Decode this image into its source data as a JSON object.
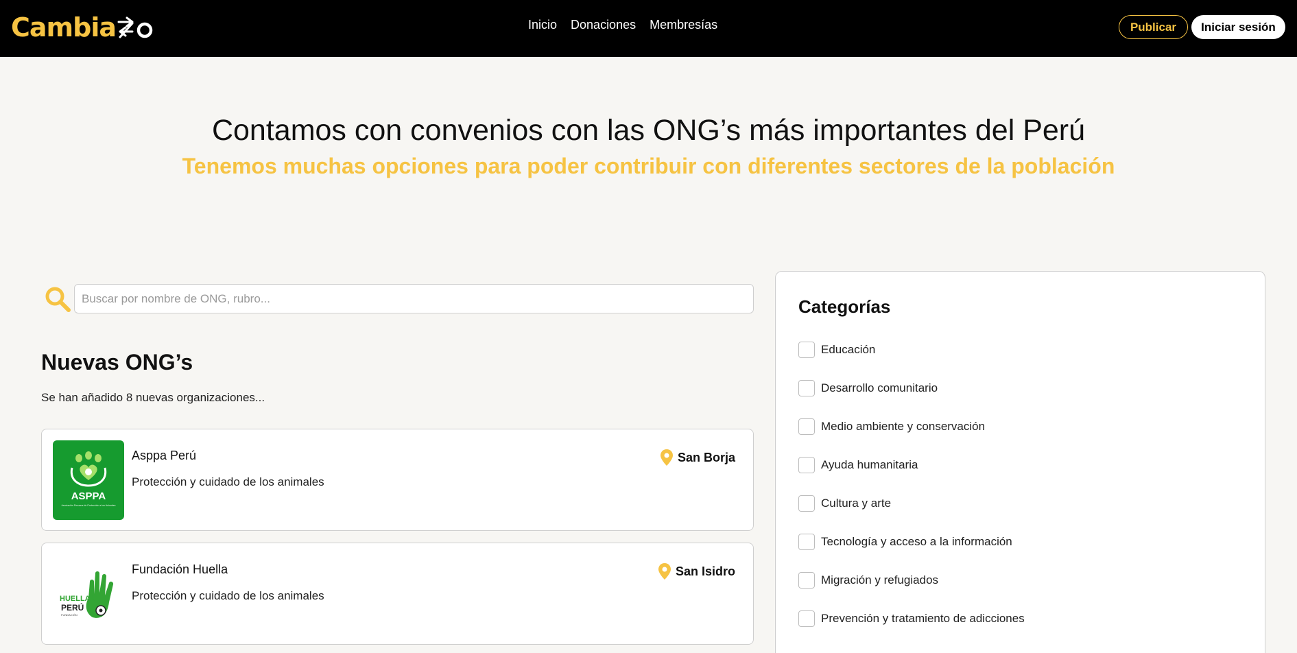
{
  "brand": {
    "name": "Cambia",
    "accent": "#f6c343",
    "nav_bg": "#000000"
  },
  "nav": {
    "links": [
      "Inicio",
      "Donaciones",
      "Membresías"
    ],
    "publish_label": "Publicar",
    "login_label": "Iniciar sesión"
  },
  "hero": {
    "title": "Contamos con convenios con las ONG’s más importantes del Perú",
    "subtitle": "Tenemos muchas opciones para poder contribuir con diferentes sectores de la población"
  },
  "search": {
    "placeholder": "Buscar por nombre de ONG, rubro...",
    "icon": "search-icon"
  },
  "new_ngos": {
    "title": "Nuevas ONG’s",
    "subtitle": "Se han añadido 8 nuevas organizaciones...",
    "items": [
      {
        "name": "Asppa Perú",
        "description": "Protección y cuidado de los animales",
        "location": "San Borja",
        "logo_text": "ASPPA",
        "logo_caption": "Asociación Peruana de Protección a los Animales",
        "logo_bg": "#169b2f"
      },
      {
        "name": "Fundación Huella",
        "description": "Protección y cuidado de los animales",
        "location": "San Isidro",
        "logo_text_top": "HUELLAS",
        "logo_text_bottom": "PERÚ",
        "logo_caption": "FUNDACIÓN",
        "logo_color": "#33a534"
      }
    ]
  },
  "categories": {
    "title": "Categorías",
    "items": [
      "Educación",
      "Desarrollo comunitario",
      "Medio ambiente y conservación",
      "Ayuda humanitaria",
      "Cultura y arte",
      "Tecnología y acceso a la información",
      "Migración y refugiados",
      "Prevención y tratamiento de adicciones"
    ]
  }
}
